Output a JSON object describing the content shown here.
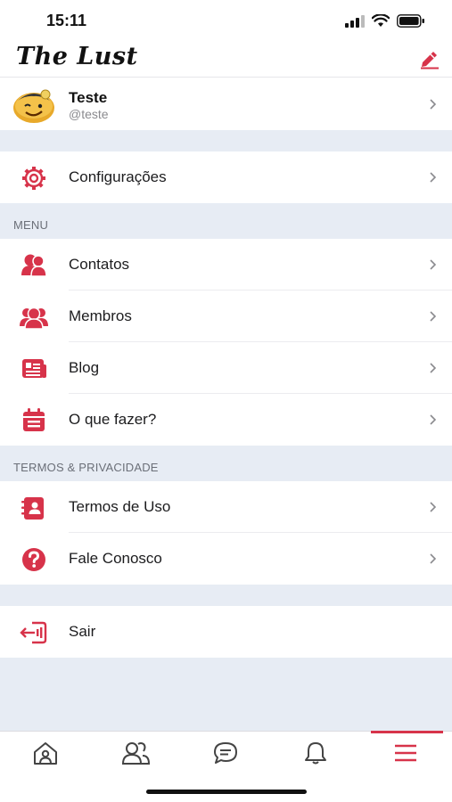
{
  "status_bar": {
    "time": "15:11"
  },
  "header": {
    "logo": "The Lust",
    "edit_icon": "edit-pen-icon"
  },
  "profile": {
    "name": "Teste",
    "handle": "@teste"
  },
  "settings": {
    "label": "Configurações",
    "icon": "gear-icon"
  },
  "menu": {
    "title": "MENU",
    "items": [
      {
        "label": "Contatos",
        "icon": "contacts-icon"
      },
      {
        "label": "Membros",
        "icon": "members-icon"
      },
      {
        "label": "Blog",
        "icon": "blog-icon"
      },
      {
        "label": "O que fazer?",
        "icon": "calendar-icon"
      }
    ]
  },
  "terms": {
    "title": "TERMOS & PRIVACIDADE",
    "items": [
      {
        "label": "Termos de Uso",
        "icon": "contact-book-icon"
      },
      {
        "label": "Fale Conosco",
        "icon": "question-icon"
      }
    ]
  },
  "logout": {
    "label": "Sair",
    "icon": "logout-icon"
  },
  "tab_bar": {
    "tabs": [
      "home-icon",
      "contacts-tab-icon",
      "chat-icon",
      "bell-icon",
      "menu-icon"
    ],
    "active": 4
  },
  "colors": {
    "accent": "#D7334A",
    "section_bg": "#E7ECF4",
    "muted": "#8A8A8E"
  }
}
